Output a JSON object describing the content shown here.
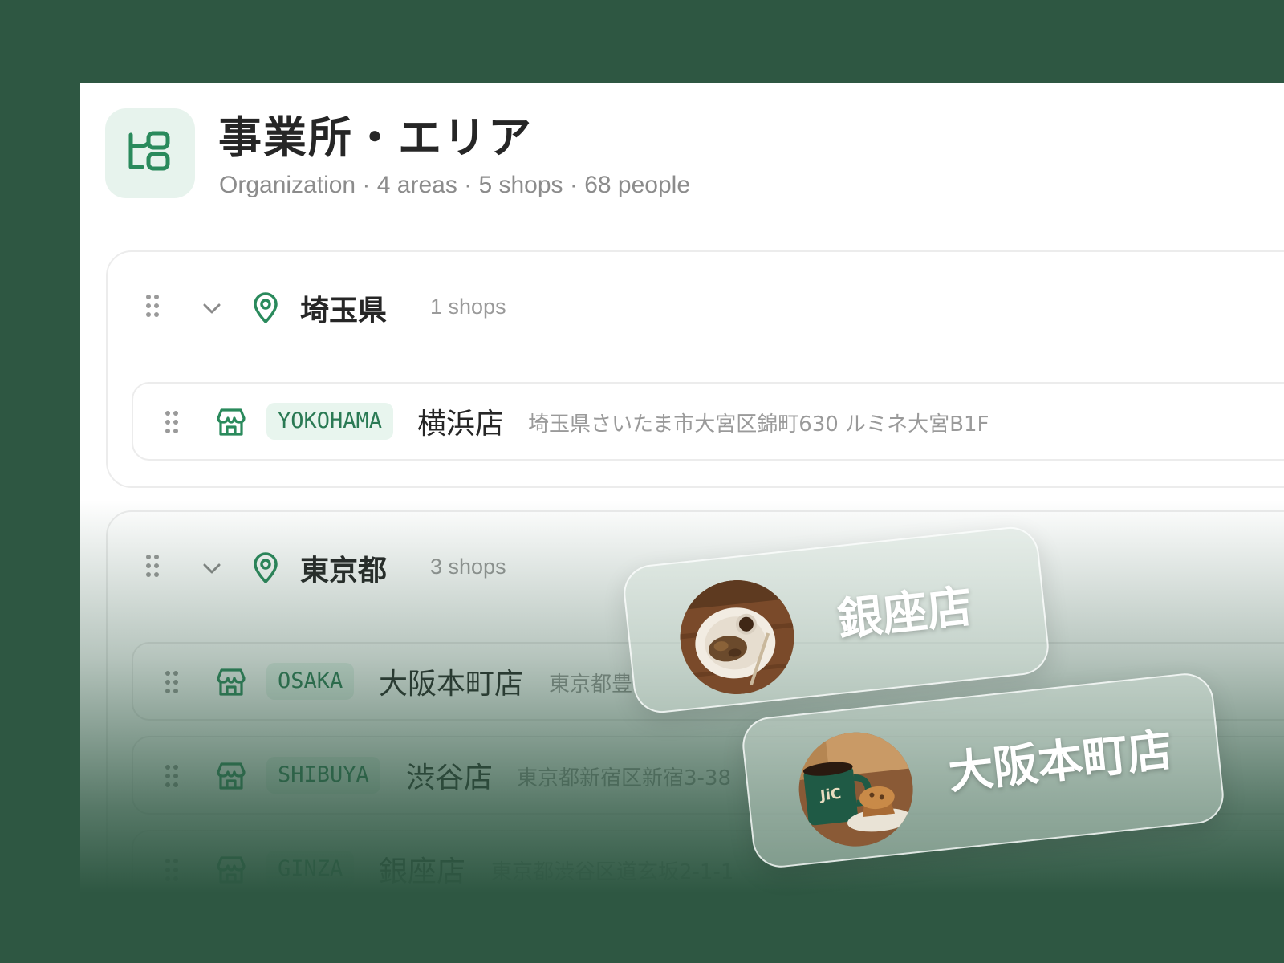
{
  "header": {
    "title": "事業所・エリア",
    "subtitle": "Organization · 4 areas · 5 shops · 68 people"
  },
  "areas": [
    {
      "name": "埼玉県",
      "count": "1 shops",
      "shops": [
        {
          "code": "YOKOHAMA",
          "name": "横浜店",
          "address": "埼玉県さいたま市大宮区錦町630 ルミネ大宮B1F"
        }
      ]
    },
    {
      "name": "東京都",
      "count": "3 shops",
      "shops": [
        {
          "code": "OSAKA",
          "name": "大阪本町店",
          "address": "東京都豊"
        },
        {
          "code": "SHIBUYA",
          "name": "渋谷店",
          "address": "東京都新宿区新宿3-38"
        },
        {
          "code": "GINZA",
          "name": "銀座店",
          "address": "東京都渋谷区道玄坂2-1-1"
        }
      ]
    }
  ],
  "floating_cards": [
    {
      "label": "銀座店",
      "image": "plate-of-food"
    },
    {
      "label": "大阪本町店",
      "image": "coffee-mug-and-muffin"
    }
  ],
  "colors": {
    "background": "#2e5742",
    "accent": "#2a7a54",
    "tag_bg": "#e8f5ee"
  },
  "icons": {
    "header": "org-tree-icon",
    "drag": "drag-handle-icon",
    "collapse": "chevron-down-icon",
    "area": "location-pin-icon",
    "shop": "storefront-icon"
  }
}
